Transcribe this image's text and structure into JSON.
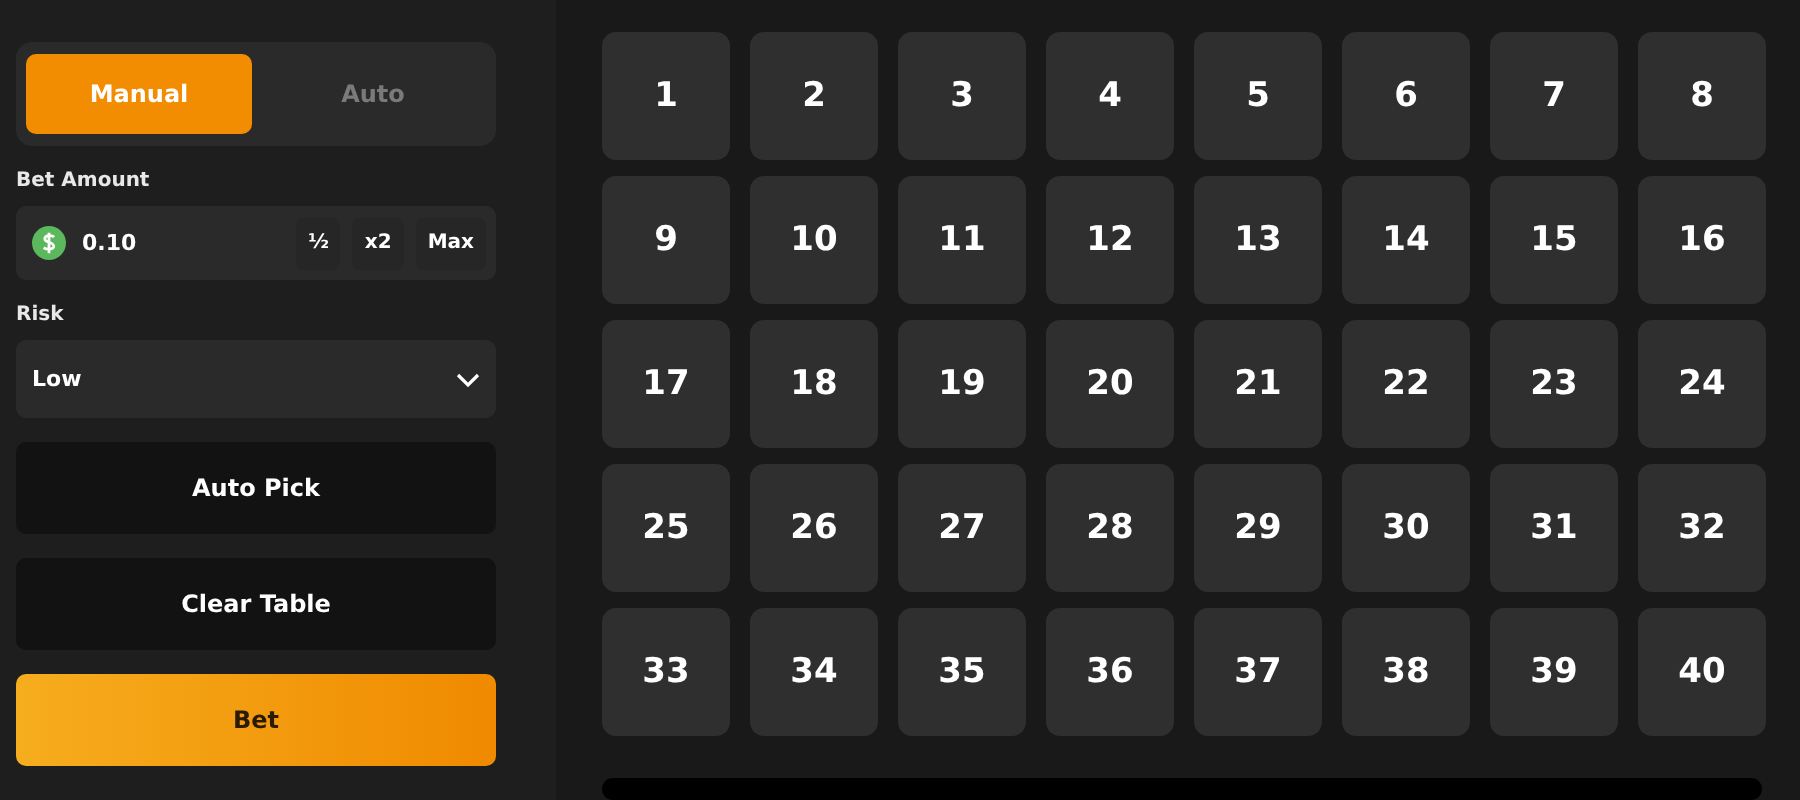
{
  "mode_tabs": [
    {
      "label": "Manual",
      "selected": true
    },
    {
      "label": "Auto",
      "selected": false
    }
  ],
  "bet_amount": {
    "label": "Bet Amount",
    "value": "0.10",
    "buttons": [
      "½",
      "x2",
      "Max"
    ]
  },
  "risk": {
    "label": "Risk",
    "value": "Low"
  },
  "actions": [
    {
      "label": "Auto Pick",
      "kind": "dark"
    },
    {
      "label": "Clear Table",
      "kind": "dark"
    },
    {
      "label": "Bet",
      "kind": "primary"
    }
  ],
  "tiles": [
    "1",
    "2",
    "3",
    "4",
    "5",
    "6",
    "7",
    "8",
    "9",
    "10",
    "11",
    "12",
    "13",
    "14",
    "15",
    "16",
    "17",
    "18",
    "19",
    "20",
    "21",
    "22",
    "23",
    "24",
    "25",
    "26",
    "27",
    "28",
    "29",
    "30",
    "31",
    "32",
    "33",
    "34",
    "35",
    "36",
    "37",
    "38",
    "39",
    "40"
  ]
}
